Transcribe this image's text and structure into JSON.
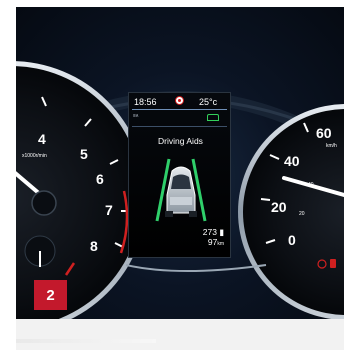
{
  "tachometer": {
    "ticks": [
      "4",
      "5",
      "6",
      "7",
      "8"
    ],
    "unit_label": "x1000r/min"
  },
  "speedometer": {
    "ticks": [
      "60",
      "40",
      "20",
      "0"
    ],
    "inner_ticks": [
      "40",
      "20"
    ],
    "unit_label": "km/h"
  },
  "display": {
    "time": "18:56",
    "temperature": "25°c",
    "title": "Driving Aids",
    "value": "273",
    "range": "97",
    "range_unit": "km"
  },
  "badge": {
    "number": "2"
  },
  "colors": {
    "badge": "#c3192c",
    "needle": "#ffffff",
    "redline": "#d02020",
    "lane": "#2fcf6a"
  }
}
